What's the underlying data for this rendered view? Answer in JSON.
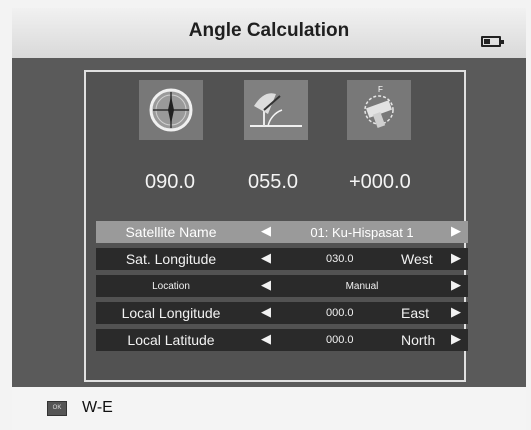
{
  "header": {
    "title": "Angle Calculation",
    "battery_icon": "battery-icon"
  },
  "angles": [
    {
      "icon": "compass-icon",
      "value": "090.0"
    },
    {
      "icon": "elevation-icon",
      "value": "055.0"
    },
    {
      "icon": "polarization-icon",
      "value": "+000.0"
    }
  ],
  "rows": {
    "satellite_name": {
      "label": "Satellite Name",
      "value": "01: Ku-Hispasat 1"
    },
    "sat_longitude": {
      "label": "Sat. Longitude",
      "number": "030.0",
      "dir": "West"
    },
    "location": {
      "label": "Location",
      "value": "Manual"
    },
    "local_longitude": {
      "label": "Local Longitude",
      "number": "000.0",
      "dir": "East"
    },
    "local_latitude": {
      "label": "Local Latitude",
      "number": "000.0",
      "dir": "North"
    }
  },
  "footer": {
    "ok_key": "OK",
    "hint": "W-E"
  },
  "colors": {
    "accent": "#9a9a9a",
    "panel": "#525252",
    "row": "#2a2a2a"
  }
}
